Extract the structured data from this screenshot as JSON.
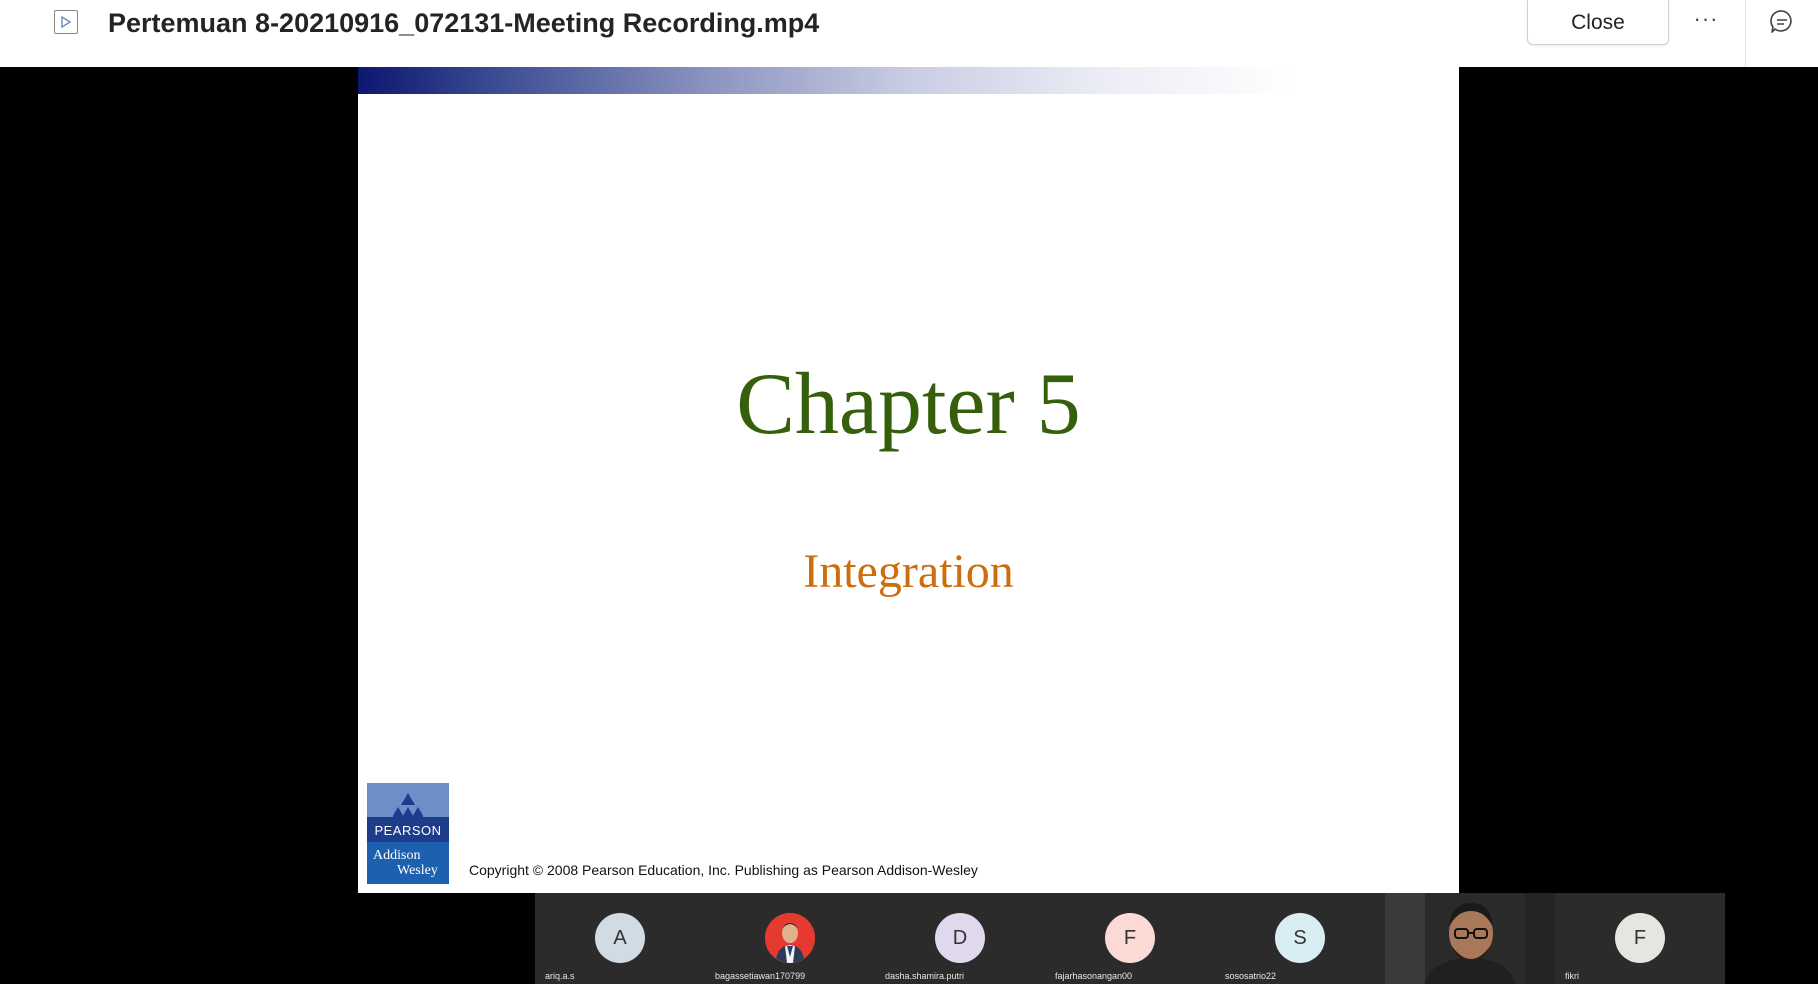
{
  "header": {
    "title": "Pertemuan 8-20210916_072131-Meeting Recording.mp4",
    "close_label": "Close",
    "more_label": "···"
  },
  "slide": {
    "chapter": "Chapter 5",
    "subtitle": "Integration",
    "logo_pearson": "PEARSON",
    "logo_addison": "Addison",
    "logo_wesley": "Wesley",
    "copyright": "Copyright © 2008 Pearson Education, Inc.  Publishing as Pearson Addison-Wesley"
  },
  "participants": [
    {
      "initial": "A",
      "name": "ariq.a.s",
      "avatar_color": "#d0dbe4"
    },
    {
      "initial": "",
      "name": "bagassetiawan170799",
      "avatar_color": "#e53a2f"
    },
    {
      "initial": "D",
      "name": "dasha.shamira.putri",
      "avatar_color": "#e0d9ee"
    },
    {
      "initial": "F",
      "name": "fajarhasonangan00",
      "avatar_color": "#fbdad6"
    },
    {
      "initial": "S",
      "name": "sososatrio22",
      "avatar_color": "#d8eef2"
    },
    {
      "initial": "",
      "name": "",
      "avatar_color": ""
    },
    {
      "initial": "F",
      "name": "fikri",
      "avatar_color": "#e4e7e0"
    }
  ]
}
